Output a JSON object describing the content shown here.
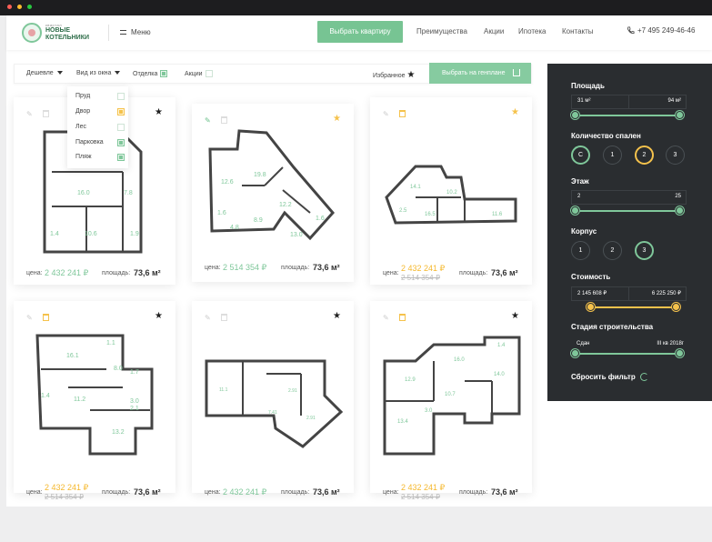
{
  "colors": {
    "accent": "#7fc79a",
    "highlight": "#f5c24c",
    "sidebar_bg": "#2a2d30"
  },
  "header": {
    "logo_small": "квартал",
    "logo_line1": "НОВЫЕ",
    "logo_line2": "КОТЕЛЬНИКИ",
    "menu": "Меню",
    "cta": "Выбрать квартиру",
    "nav": [
      "Преимущества",
      "Акции",
      "Ипотека",
      "Контакты"
    ],
    "phone": "+7 495 249-46-46"
  },
  "filters": {
    "sort": "Дешевле",
    "view": "Вид из окна",
    "finish": "Отделка",
    "promo": "Акции",
    "favorites": "Избранное",
    "plan_button": "Выбрать на генплане"
  },
  "window_view_options": [
    {
      "label": "Пруд",
      "state": "off"
    },
    {
      "label": "Двор",
      "state": "yellow"
    },
    {
      "label": "Лес",
      "state": "off"
    },
    {
      "label": "Парковка",
      "state": "on"
    },
    {
      "label": "Пляж",
      "state": "on"
    }
  ],
  "cards": [
    {
      "price_label": "цена:",
      "price": "2 432 241 ₽",
      "old_price": "",
      "area_label": "площадь:",
      "area": "73,6 м²",
      "pin": "grey",
      "gift": false,
      "star": "dark",
      "rooms": [
        "16.0",
        "7.8",
        "10.6",
        "1.4",
        "1.9"
      ]
    },
    {
      "price_label": "цена:",
      "price": "2 514 354 ₽",
      "old_price": "",
      "area_label": "площадь:",
      "area": "73,6 м²",
      "pin": "green",
      "gift": false,
      "star": "yellow",
      "rooms": [
        "12.6",
        "19.8",
        "12.2",
        "8.9",
        "13.0",
        "1.6",
        "4.8",
        "1.6"
      ]
    },
    {
      "price_label": "цена:",
      "price": "2 432 241 ₽",
      "old_price": "2 514 354 ₽",
      "area_label": "площадь:",
      "area": "73,6 м²",
      "pin": "grey",
      "gift": true,
      "star": "yellow",
      "rooms": [
        "14.1",
        "10.2",
        "16.5",
        "11.6",
        "2.5"
      ]
    },
    {
      "price_label": "цена:",
      "price": "2 432 241 ₽",
      "old_price": "2 514 354 ₽",
      "area_label": "площадь:",
      "area": "73,6 м²",
      "pin": "grey",
      "gift": true,
      "star": "dark",
      "rooms": [
        "16.1",
        "1.1",
        "8.0",
        "1.7",
        "11.2",
        "3.0",
        "1.4",
        "13.2",
        "2.1"
      ]
    },
    {
      "price_label": "цена:",
      "price": "2 432 241 ₽",
      "old_price": "",
      "area_label": "площадь:",
      "area": "73,6 м²",
      "pin": "grey",
      "gift": false,
      "star": "dark",
      "rooms": [
        "11.1",
        "2.91",
        "7.41",
        "2.91"
      ]
    },
    {
      "price_label": "цена:",
      "price": "2 432 241 ₽",
      "old_price": "2 514 354 ₽",
      "area_label": "площадь:",
      "area": "73,6 м²",
      "pin": "grey",
      "gift": true,
      "star": "dark",
      "rooms": [
        "16.0",
        "1.4",
        "12.9",
        "14.0",
        "10.7",
        "3.0",
        "13.4"
      ]
    }
  ],
  "sidebar": {
    "area": {
      "title": "Площадь",
      "min": "31 м²",
      "max": "94 м²"
    },
    "bedrooms": {
      "title": "Количество спален",
      "options": [
        {
          "label": "С",
          "state": "green"
        },
        {
          "label": "1",
          "state": "off"
        },
        {
          "label": "2",
          "state": "yellow"
        },
        {
          "label": "3",
          "state": "off"
        }
      ]
    },
    "floor": {
      "title": "Этаж",
      "min": "2",
      "max": "25"
    },
    "building": {
      "title": "Корпус",
      "options": [
        {
          "label": "1",
          "state": "off"
        },
        {
          "label": "2",
          "state": "off"
        },
        {
          "label": "3",
          "state": "green"
        }
      ]
    },
    "price": {
      "title": "Стоимость",
      "min": "2 145 608 ₽",
      "max": "6 225 250 ₽"
    },
    "stage": {
      "title": "Стадия строительства",
      "from": "Сдан",
      "to": "III кв 2018г"
    },
    "reset": "Сбросить фильтр"
  }
}
